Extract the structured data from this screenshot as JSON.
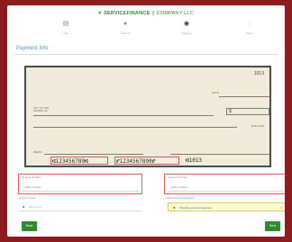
{
  "header": {
    "logo_mark": "≠",
    "brand": "SERVICEFINANCE",
    "separator": "|",
    "sub": "COMPANY LLC"
  },
  "steps": [
    {
      "icon": "document-icon",
      "glyph": "▤",
      "label": "Info"
    },
    {
      "icon": "user-icon",
      "glyph": "●",
      "label": "Account"
    },
    {
      "icon": "bank-icon",
      "glyph": "◉",
      "label": "Payment"
    },
    {
      "icon": "check-icon",
      "glyph": "◌",
      "label": "Done"
    }
  ],
  "page_title": "Payment Info",
  "cheque": {
    "number": "1013",
    "date_label": "DATE",
    "pay_label_line1": "PAY TO THE",
    "pay_label_line2": "ORDER OF",
    "amount_prefix": "$",
    "dollars_label": "DOLLARS",
    "memo_label": "MEMO",
    "micr_routing": "⑆123456789⑆",
    "micr_account": "⑈1234567890⑈",
    "micr_check": "⑆1013"
  },
  "fields": {
    "routing": {
      "label": "Routing Number",
      "value": "  enter number"
    },
    "account": {
      "label": "Account Number",
      "value": "  enter number"
    }
  },
  "selects": {
    "account_type": {
      "label": "Account Type",
      "bullet": "●",
      "value": "Select one",
      "caret": "▾"
    },
    "payment_method": {
      "label": "Select Account Method",
      "bullet": "●",
      "value": "Checking account selected",
      "caret": "▾"
    }
  },
  "buttons": {
    "back": "Back",
    "next": "Next"
  },
  "colors": {
    "frame": "#8e1b1d",
    "brand": "#2e8a2e",
    "cheque": "#f0ecd9",
    "error_border": "#e05b5b",
    "highlight": "#fffbd0"
  }
}
